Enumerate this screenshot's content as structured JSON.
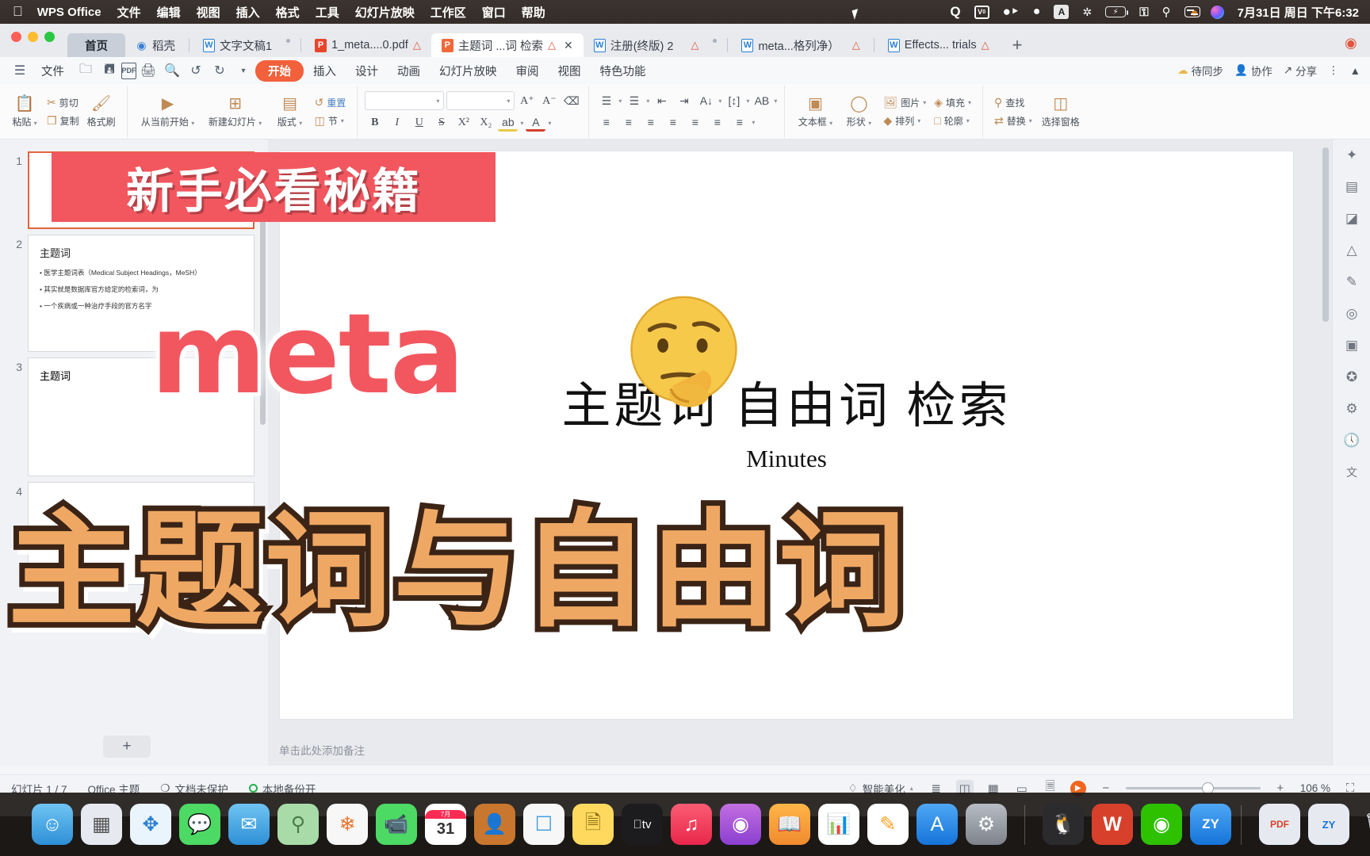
{
  "menubar": {
    "apple_icon": "apple-icon",
    "app_name": "WPS Office",
    "items": [
      "文件",
      "编辑",
      "视图",
      "插入",
      "格式",
      "工具",
      "幻灯片放映",
      "工作区",
      "窗口",
      "帮助"
    ],
    "tray": [
      {
        "name": "quark-icon",
        "glyph": "Q"
      },
      {
        "name": "youdao-dict-icon",
        "glyph": "V0"
      },
      {
        "name": "wechat-icon",
        "glyph": "◕"
      },
      {
        "name": "qq-icon",
        "glyph": "🐧"
      },
      {
        "name": "input-method-icon",
        "glyph": "A"
      },
      {
        "name": "bluetooth-icon",
        "glyph": "✱"
      },
      {
        "name": "battery-icon",
        "glyph": "⚡"
      },
      {
        "name": "wifi-icon",
        "glyph": "wifi"
      },
      {
        "name": "spotlight-search-icon",
        "glyph": "⌕"
      },
      {
        "name": "control-center-icon",
        "glyph": "ctrl"
      },
      {
        "name": "siri-icon",
        "glyph": "siri"
      }
    ],
    "clock": "7月31日 周日 下午6:32"
  },
  "tabstrip": {
    "home_label": "首页",
    "docer_label": "稻壳",
    "tabs": [
      {
        "label": "文字文稿1",
        "icon": "word-file-icon",
        "warn": false,
        "active": false
      },
      {
        "label": "1_meta....0.pdf",
        "icon": "pdf-file-icon",
        "warn": true,
        "active": false
      },
      {
        "label": "主题词 ...词 检索",
        "icon": "ppt-file-icon",
        "warn": true,
        "active": true,
        "closable": true
      },
      {
        "label": "注册(终版) 2",
        "icon": "word-file-icon",
        "warn": true,
        "active": false
      },
      {
        "label": "meta...格列净）",
        "icon": "word-file-icon",
        "warn": true,
        "active": false
      },
      {
        "label": "Effects... trials",
        "icon": "word-file-icon",
        "warn": true,
        "active": false
      }
    ],
    "new_tab_label": "+"
  },
  "ribbon_tabs": {
    "menu_icon": "hamburger-icon",
    "file_label": "文件",
    "quick_icons": [
      {
        "name": "open-folder-icon",
        "glyph": "🗀"
      },
      {
        "name": "save-icon",
        "glyph": "🖫"
      },
      {
        "name": "export-pdf-icon",
        "glyph": "PDF"
      },
      {
        "name": "print-icon",
        "glyph": "🖨"
      },
      {
        "name": "print-preview-icon",
        "glyph": "🔍"
      },
      {
        "name": "undo-icon",
        "glyph": "↺"
      },
      {
        "name": "redo-icon",
        "glyph": "↻"
      },
      {
        "name": "customize-quick-access-icon",
        "glyph": "⌄"
      }
    ],
    "tabs": [
      "开始",
      "插入",
      "设计",
      "动画",
      "幻灯片放映",
      "审阅",
      "视图",
      "特色功能"
    ],
    "selected_tab": "开始",
    "right_items": [
      {
        "label": "待同步",
        "icon": "cloud-sync-icon"
      },
      {
        "label": "协作",
        "icon": "collaborate-icon"
      },
      {
        "label": "分享",
        "icon": "share-icon"
      },
      {
        "label": "",
        "icon": "more-options-icon"
      },
      {
        "label": "",
        "icon": "collapse-ribbon-icon"
      }
    ]
  },
  "ribbon": {
    "clipboard": {
      "paste_label": "粘贴",
      "cut_label": "剪切",
      "copy_label": "复制",
      "format_painter_label": "格式刷"
    },
    "slides": {
      "from_current_label": "从当前开始",
      "new_slide_label": "新建幻灯片",
      "layout_label": "版式",
      "reset_label": "重置",
      "section_label": "节"
    },
    "font": {
      "family_value": "",
      "family_placeholder": "",
      "size_value": "",
      "size_placeholder": "",
      "grow_font": "A⁺",
      "shrink_font": "A⁻",
      "clear_format": "⌫",
      "bold": "B",
      "italic": "I",
      "underline": "U",
      "strikethrough": "S",
      "superscript": "X²",
      "subscript": "X₂",
      "text_highlight": "ab",
      "font_color": "A"
    },
    "paragraph": {
      "bullets": "☰",
      "numbering": "☰",
      "decrease_indent": "⇤",
      "increase_indent": "⇥",
      "text_direction": "A↓",
      "line_spacing": "[↕]",
      "text_align_box": "AB",
      "align_left": "≡",
      "align_center": "≡",
      "align_right": "≡",
      "justify": "≡",
      "distribute": "≡",
      "columns": "≡",
      "list_level": "≡"
    },
    "insert": {
      "textbox_label": "文本框",
      "shape_label": "形状",
      "picture_label": "图片",
      "arrange_label": "排列",
      "fill_label": "填充",
      "outline_label": "轮廓"
    },
    "editing": {
      "find_label": "查找",
      "replace_label": "替换",
      "select_pane_label": "选择窗格"
    }
  },
  "thumbnails": {
    "items": [
      {
        "number": "1",
        "title": "主题词 自由词 检索",
        "subtitle": "Minutes",
        "selected": true
      },
      {
        "number": "2",
        "title": "主题词",
        "bullets": [
          "医学主题词表（Medical Subject Headings，MeSH）",
          "其实就是数据库官方给定的检索词，为",
          "一个疾病或一种治疗手段的官方名字"
        ],
        "highlight": "官方名字",
        "selected": false
      },
      {
        "number": "3",
        "title": "主题词",
        "selected": false
      },
      {
        "number": "4",
        "title": "",
        "selected": false
      }
    ],
    "add_slide_label": "+"
  },
  "slide": {
    "title": "主题词 自由词 检索",
    "subtitle": "Minutes",
    "notes_placeholder": "单击此处添加备注"
  },
  "right_gutter": {
    "icons": [
      {
        "name": "design-ideas-icon",
        "glyph": "✧"
      },
      {
        "name": "template-icon",
        "glyph": "▤"
      },
      {
        "name": "chart-icon",
        "glyph": "◪"
      },
      {
        "name": "warning-icon",
        "glyph": "△"
      },
      {
        "name": "pen-icon",
        "glyph": "✎"
      },
      {
        "name": "picture-tools-icon",
        "glyph": "◎"
      },
      {
        "name": "transition-icon",
        "glyph": "▣"
      },
      {
        "name": "magic-icon",
        "glyph": "✦"
      },
      {
        "name": "animation-icon",
        "glyph": "⚙"
      },
      {
        "name": "history-icon",
        "glyph": "🕓"
      },
      {
        "name": "translate-icon",
        "glyph": "文"
      }
    ]
  },
  "statusbar": {
    "slide_count": "幻灯片 1 / 7",
    "theme": "Office 主题",
    "protection": "文档未保护",
    "backup": "本地备份开",
    "beautify": "智能美化",
    "view_icons": [
      {
        "name": "outline-view-icon",
        "glyph": "≡"
      },
      {
        "name": "normal-view-icon",
        "glyph": "▯",
        "selected": true
      },
      {
        "name": "slide-sorter-icon",
        "glyph": "▦"
      },
      {
        "name": "reading-view-icon",
        "glyph": "▭"
      },
      {
        "name": "notes-view-icon",
        "glyph": "🗒"
      },
      {
        "name": "play-slideshow-icon",
        "glyph": "▶"
      }
    ],
    "zoom_minus": "−",
    "zoom_plus": "+",
    "zoom_level": "106 %",
    "fit_icon": "fit-to-window-icon"
  },
  "overlays": {
    "banner_text": "新手必看秘籍",
    "meta_text": "meta",
    "emoji": "thinking-face-emoji",
    "big_caption": "主题词与自由词",
    "banner_color": "#f2575f",
    "caption_fill": "#efa864",
    "caption_stroke": "#3b2416"
  },
  "dock": {
    "icons": [
      {
        "name": "finder-icon",
        "glyph": "🙂",
        "color": "#3b9ae1"
      },
      {
        "name": "launchpad-icon",
        "glyph": "▦",
        "color": "#dfe3e8"
      },
      {
        "name": "safari-icon",
        "glyph": "🧭",
        "color": "#e8f3fd"
      },
      {
        "name": "messages-icon",
        "glyph": "💬",
        "color": "#4cd964"
      },
      {
        "name": "mail-icon",
        "glyph": "✉",
        "color": "#3b9ae1"
      },
      {
        "name": "maps-icon",
        "glyph": "🗺",
        "color": "#8fd78f"
      },
      {
        "name": "photos-icon",
        "glyph": "❀",
        "color": "#f5f5f5"
      },
      {
        "name": "facetime-icon",
        "glyph": "📹",
        "color": "#4cd964"
      },
      {
        "name": "calendar-icon",
        "glyph": "31",
        "color": "#ffffff"
      },
      {
        "name": "contacts-icon",
        "glyph": "👤",
        "color": "#c9762e"
      },
      {
        "name": "reminders-icon",
        "glyph": "☑",
        "color": "#f5f5f5"
      },
      {
        "name": "notes-icon",
        "glyph": "🗒",
        "color": "#ffd95e"
      },
      {
        "name": "appletv-icon",
        "glyph": "tv",
        "color": "#1c1c1e"
      },
      {
        "name": "music-icon",
        "glyph": "♪",
        "color": "#fa2c54"
      },
      {
        "name": "podcasts-icon",
        "glyph": "◉",
        "color": "#9b5de5"
      },
      {
        "name": "appstore-books-icon",
        "glyph": "📖",
        "color": "#e8762e"
      },
      {
        "name": "numbers-icon",
        "glyph": "📊",
        "color": "#4cd964"
      },
      {
        "name": "pages-icon",
        "glyph": "✎",
        "color": "#ff9f1c"
      },
      {
        "name": "appstore-icon",
        "glyph": "A",
        "color": "#1e90ff"
      },
      {
        "name": "system-preferences-icon",
        "glyph": "⚙",
        "color": "#8e8e93"
      },
      {
        "name": "qq-icon",
        "glyph": "🐧",
        "color": "#2b2b2e"
      },
      {
        "name": "wps-writer-icon",
        "glyph": "W",
        "color": "#d7402b"
      },
      {
        "name": "wechat-icon",
        "glyph": "◕",
        "color": "#2dc100"
      },
      {
        "name": "zy-icon",
        "glyph": "ZY",
        "color": "#1e90ff"
      }
    ],
    "right_icons": [
      {
        "name": "pdf-folder-icon",
        "glyph": "PDF",
        "color": "#e0e3e8"
      },
      {
        "name": "zy-stack-icon",
        "glyph": "ZY",
        "color": "#e0e3e8"
      },
      {
        "name": "trash-icon",
        "glyph": "🗑",
        "color": "transparent"
      }
    ]
  }
}
